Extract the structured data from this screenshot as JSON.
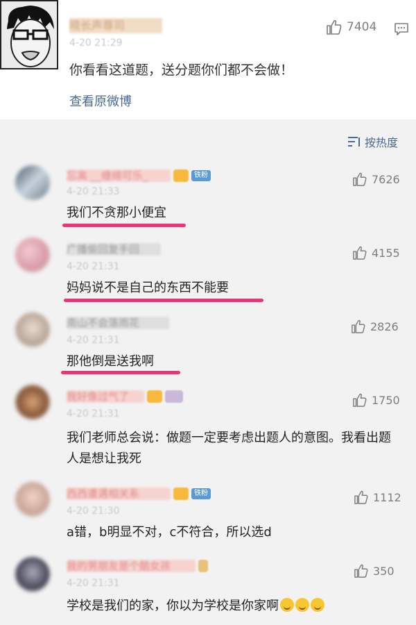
{
  "post": {
    "author": "晓长声尊司",
    "time": "4-20 21:29",
    "text": "你看看这道题，送分题你们都不会做！",
    "view_original": "查看原微博",
    "likes": "7404"
  },
  "sort_label": "按热度",
  "comments": [
    {
      "name": "忘离 __缠绵可乐_",
      "badge": "铁粉",
      "time": "4-20 21:33",
      "text": "我们不贪那小便宜",
      "likes": "7626"
    },
    {
      "name": "广播偷回复手回",
      "time": "4-20 21:31",
      "text": "妈妈说不是自己的东西不能要",
      "likes": "4155"
    },
    {
      "name": "南山不会落雨花",
      "time": "4-20 21:31",
      "text": "那他倒是送我啊",
      "likes": "2826"
    },
    {
      "name": "我好像过气了",
      "time": "4-20 21:31",
      "text": "我们老师总会说：做题一定要考虑出题人的意图。我看出题人是想让我死",
      "likes": "1750"
    },
    {
      "name": "西西遭遇相关系",
      "badge": "铁粉",
      "time": "4-20 21:30",
      "text": "a错，b明显不对，c不符合，所以选d",
      "likes": "1112"
    },
    {
      "name": "我的男朋友是个酷女孩",
      "time": "4-20 21:31",
      "text": "学校是我们的家，你以为学校是你家啊",
      "likes": "350"
    }
  ],
  "colors": {
    "link": "#4a6b91",
    "underline": "#e8347a",
    "badge": "#5a9bd6"
  }
}
